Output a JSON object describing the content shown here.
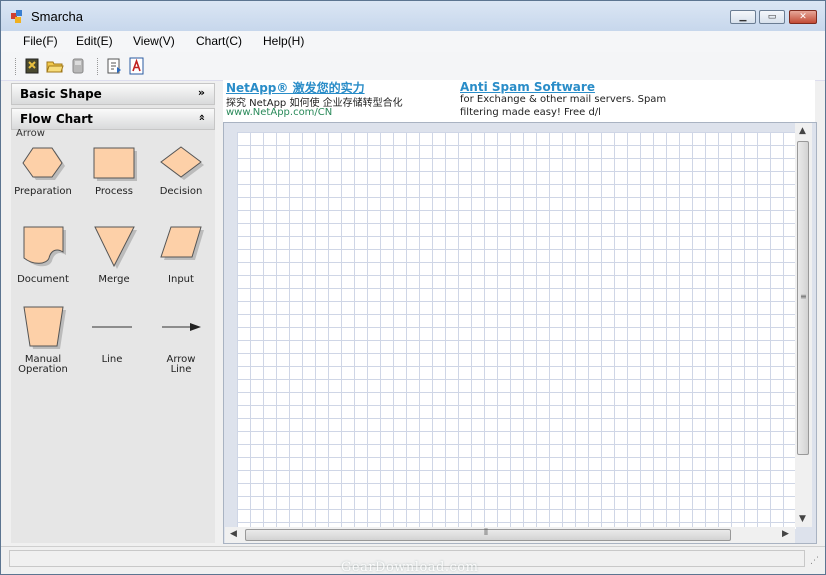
{
  "window": {
    "title": "Smarcha"
  },
  "menu": [
    "File(F)",
    "Edit(E)",
    "View(V)",
    "Chart(C)",
    "Help(H)"
  ],
  "toolbar": {
    "icons": [
      "new-icon",
      "open-icon",
      "save-icon",
      "export-icon",
      "text-icon"
    ]
  },
  "sidebar": {
    "basic_shape": "Basic Shape",
    "flow_chart": "Flow Chart",
    "arrow_partial": "Arrow",
    "shapes": [
      {
        "label": "Preparation",
        "icon": "hexagon-icon"
      },
      {
        "label": "Process",
        "icon": "rectangle-icon"
      },
      {
        "label": "Decision",
        "icon": "diamond-icon"
      },
      {
        "label": "Document",
        "icon": "document-shape-icon"
      },
      {
        "label": "Merge",
        "icon": "triangle-icon"
      },
      {
        "label": "Input",
        "icon": "parallelogram-icon"
      },
      {
        "label": "Manual\nOperation",
        "icon": "trapezoid-icon"
      },
      {
        "label": "Line",
        "icon": "line-icon"
      },
      {
        "label": "Arrow\nLine",
        "icon": "arrow-line-icon"
      }
    ]
  },
  "ads": [
    {
      "title": "NetApp® 激发您的实力",
      "text": "探究 NetApp 如何使 企业存储转型合化",
      "url": "www.NetApp.com/CN"
    },
    {
      "title": "Anti Spam Software",
      "text": "for Exchange & other mail servers. Spam",
      "text2": "filtering made easy! Free d/l"
    }
  ],
  "watermark": "GearDownload.com",
  "colors": {
    "shape_fill": "#fdd0a8",
    "shape_stroke": "#555555",
    "grid_line": "#cfd6e6",
    "ad_link": "#2a8dc8"
  }
}
